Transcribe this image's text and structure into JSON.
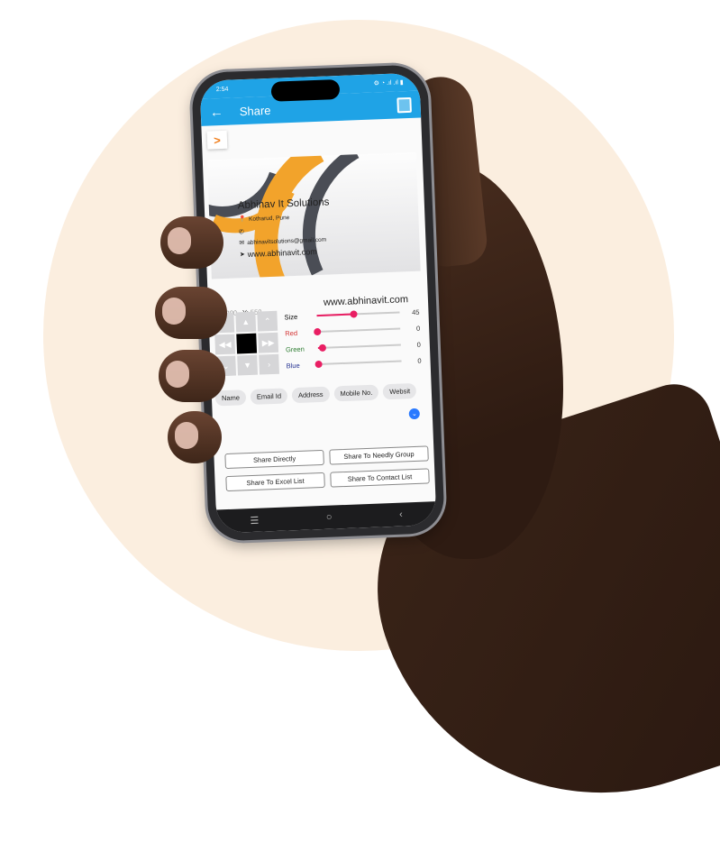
{
  "colors": {
    "accent": "#1fa3e6",
    "slider": "#e91e63",
    "background_circle": "#fbeedf",
    "card_orange": "#f2a32b"
  },
  "statusbar": {
    "time": "2:54",
    "indicators": "⚙ ◔ .ıl .ıl ▮"
  },
  "appbar": {
    "back_icon": "arrow-left-icon",
    "title": "Share",
    "action_icon": "save-icon"
  },
  "toolbar": {
    "expand_glyph": ">"
  },
  "card": {
    "company": "Abhinav It Solutions",
    "location": "Kotharud, Pune",
    "phone": "",
    "email": "abhinavitsolutions@gmail.com",
    "website": "www.abhinavit.com"
  },
  "position": {
    "x_label": "X:",
    "x_value": "200",
    "y_label": "Y:",
    "y_value": "550",
    "preview_text": "www.abhinavit.com"
  },
  "dpad": {
    "up_left": "‹",
    "up": "▲",
    "up_right": "⌃",
    "left": "◀◀",
    "right": "▶▶",
    "down_left": "⌄",
    "down": "▼",
    "down_right": "›"
  },
  "sliders": [
    {
      "label": "Size",
      "value": "45",
      "level": 0.45,
      "color": "#222222"
    },
    {
      "label": "Red",
      "value": "0",
      "level": 0.0,
      "color": "#d32f2f"
    },
    {
      "label": "Green",
      "value": "0",
      "level": 0.05,
      "color": "#2e7d32"
    },
    {
      "label": "Blue",
      "value": "0",
      "level": 0.0,
      "color": "#283593"
    }
  ],
  "chips": [
    "Name",
    "Email Id",
    "Address",
    "Mobile No.",
    "Websit"
  ],
  "buttons": {
    "share_directly": "Share Directly",
    "share_needly_group": "Share To Needly Group",
    "share_excel": "Share To Excel List",
    "share_contact": "Share To Contact List"
  },
  "navbar": {
    "menu": "☰",
    "home": "○",
    "back": "‹"
  }
}
